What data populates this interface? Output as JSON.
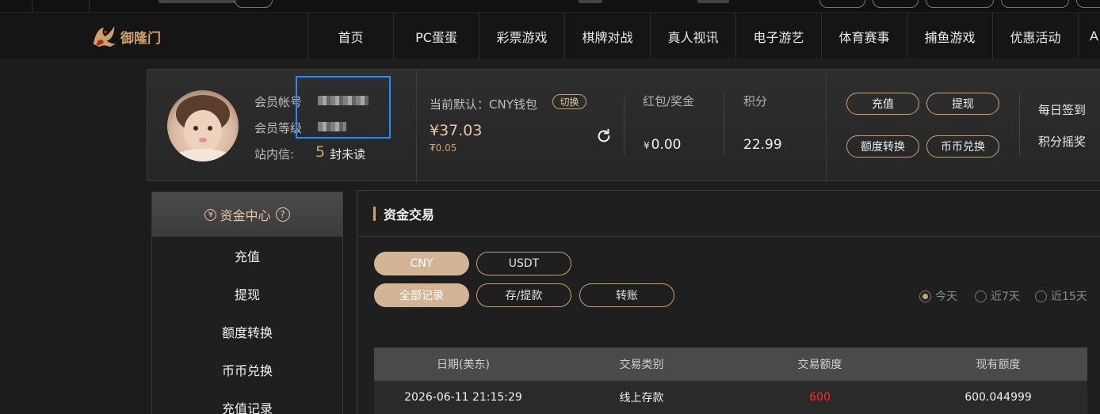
{
  "nav": {
    "logo_text": "御隆门",
    "items": [
      {
        "label": "首页"
      },
      {
        "label": "PC蛋蛋"
      },
      {
        "label": "彩票游戏"
      },
      {
        "label": "棋牌对战"
      },
      {
        "label": "真人视讯"
      },
      {
        "label": "电子游艺"
      },
      {
        "label": "体育赛事"
      },
      {
        "label": "捕鱼游戏"
      },
      {
        "label": "优惠活动"
      },
      {
        "label": "A"
      }
    ]
  },
  "user": {
    "account_label": "会员帐号",
    "level_label": "会员等级",
    "inbox_label": "站内信:",
    "unread_count": "5",
    "unread_suffix": "封未读",
    "wallet_label": "当前默认：CNY钱包",
    "switch_label": "切换",
    "balance": "¥37.03",
    "balance_sub": "₮0.05",
    "bonus_label": "红包/奖金",
    "bonus_currency": "¥",
    "bonus_value": "0.00",
    "points_label": "积分",
    "points_value": "22.99",
    "buttons": {
      "deposit": "充值",
      "withdraw": "提现",
      "transfer": "额度转换",
      "exchange": "币币兑换"
    },
    "side_links": {
      "checkin": "每日签到",
      "shake": "积分摇奖"
    }
  },
  "sidebar": {
    "title": "资金中心",
    "title_icon": "¥",
    "help_icon": "?",
    "items": [
      {
        "label": "充值"
      },
      {
        "label": "提现"
      },
      {
        "label": "额度转换"
      },
      {
        "label": "币币兑换"
      },
      {
        "label": "充值记录"
      }
    ]
  },
  "main": {
    "title": "资金交易",
    "currency_tabs": [
      {
        "label": "CNY",
        "active": true
      },
      {
        "label": "USDT",
        "active": false
      }
    ],
    "type_tabs": [
      {
        "label": "全部记录",
        "active": true
      },
      {
        "label": "存/提款",
        "active": false
      },
      {
        "label": "转账",
        "active": false
      }
    ],
    "range_options": [
      {
        "label": "今天",
        "selected": true
      },
      {
        "label": "近7天",
        "selected": false
      },
      {
        "label": "近15天",
        "selected": false
      }
    ],
    "table": {
      "headers": [
        "日期(美东)",
        "交易类别",
        "交易额度",
        "现有额度"
      ],
      "rows": [
        {
          "date": "2026-06-11 21:15:29",
          "type": "线上存款",
          "amount": "600",
          "balance": "600.044999"
        }
      ]
    }
  }
}
